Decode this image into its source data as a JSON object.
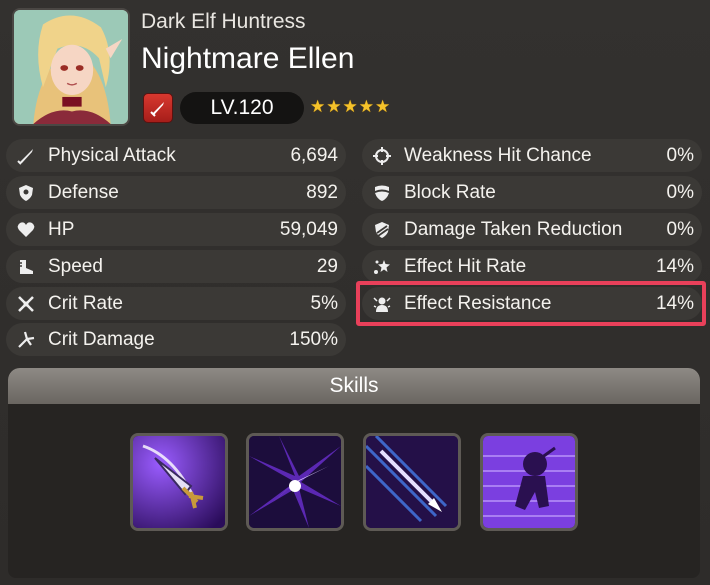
{
  "hero": {
    "subtitle": "Dark Elf Huntress",
    "name": "Nightmare Ellen",
    "level": "LV.120",
    "stars": "★★★★★",
    "class_icon": "sword-icon"
  },
  "stats_left": [
    {
      "label": "Physical Attack",
      "value": "6,694",
      "icon": "sword-icon"
    },
    {
      "label": "Defense",
      "value": "892",
      "icon": "shield-icon"
    },
    {
      "label": "HP",
      "value": "59,049",
      "icon": "heart-icon"
    },
    {
      "label": "Speed",
      "value": "29",
      "icon": "boot-icon"
    },
    {
      "label": "Crit Rate",
      "value": "5%",
      "icon": "crit-rate-icon"
    },
    {
      "label": "Crit Damage",
      "value": "150%",
      "icon": "crit-damage-icon"
    }
  ],
  "stats_right": [
    {
      "label": "Weakness Hit Chance",
      "value": "0%",
      "icon": "crosshair-icon"
    },
    {
      "label": "Block Rate",
      "value": "0%",
      "icon": "block-icon"
    },
    {
      "label": "Damage Taken Reduction",
      "value": "0%",
      "icon": "damage-reduction-icon"
    },
    {
      "label": "Effect Hit Rate",
      "value": "14%",
      "icon": "effect-hit-icon"
    },
    {
      "label": "Effect Resistance",
      "value": "14%",
      "icon": "effect-resistance-icon"
    }
  ],
  "highlighted_stat": "Effect Resistance",
  "skills": {
    "title": "Skills",
    "icons": [
      "dagger-skill-icon",
      "burst-skill-icon",
      "spear-skill-icon",
      "dash-skill-icon"
    ]
  },
  "colors": {
    "background": "#2f2d2b",
    "row": "#3b3936",
    "highlight": "#e8405a",
    "star": "#f5c22a",
    "skill_purple": "#6b2fd1"
  }
}
